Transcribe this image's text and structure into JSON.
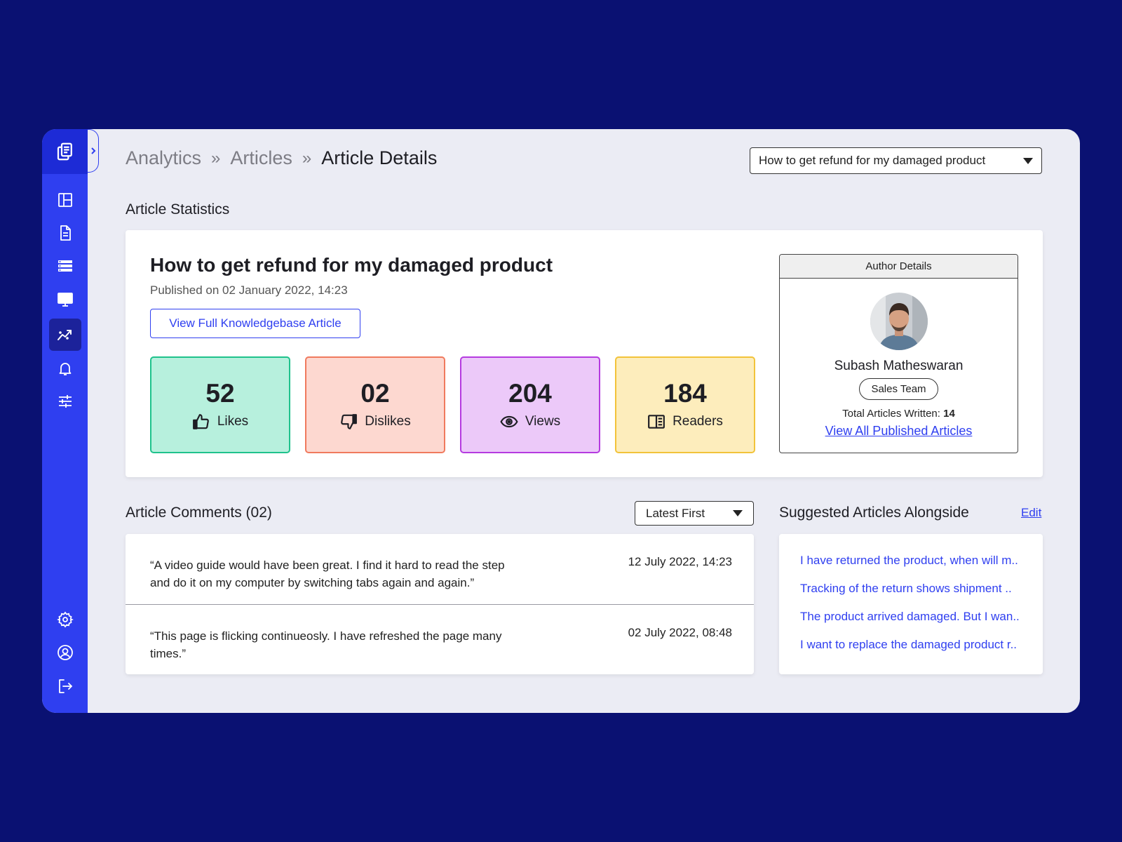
{
  "breadcrumb": {
    "items": [
      "Analytics",
      "Articles"
    ],
    "current": "Article Details"
  },
  "article_select": {
    "value": "How to get refund for my damaged product"
  },
  "statistics": {
    "section_title": "Article Statistics",
    "title": "How to get refund for my damaged product",
    "published": "Published on 02 January 2022, 14:23",
    "view_button": "View Full Knowledgebase Article",
    "stats": [
      {
        "value": "52",
        "label": "Likes",
        "icon": "thumbs-up-icon",
        "bg": "#b7f0dd",
        "border": "#1fc28c"
      },
      {
        "value": "02",
        "label": "Dislikes",
        "icon": "thumbs-down-icon",
        "bg": "#fdd8d0",
        "border": "#f07a5e"
      },
      {
        "value": "204",
        "label": "Views",
        "icon": "eye-icon",
        "bg": "#ecc9f9",
        "border": "#b53be0"
      },
      {
        "value": "184",
        "label": "Readers",
        "icon": "book-icon",
        "bg": "#fdedbc",
        "border": "#f2c33a"
      }
    ]
  },
  "author": {
    "heading": "Author Details",
    "name": "Subash Matheswaran",
    "team": "Sales Team",
    "total_label": "Total Articles Written:",
    "total_value": "14",
    "link": "View All Published Articles"
  },
  "comments": {
    "section_title": "Article Comments (02)",
    "sort": "Latest First",
    "items": [
      {
        "text": "“A video guide would have been great. I find it hard to read the step and do it on my computer by switching tabs again and again.”",
        "time": "12 July 2022, 14:23"
      },
      {
        "text": "“This page is flicking continueosly. I have refreshed the page many times.”",
        "time": "02 July 2022, 08:48"
      }
    ]
  },
  "suggested": {
    "section_title": "Suggested Articles Alongside",
    "edit": "Edit",
    "items": [
      "I have returned the product, when will m..",
      "Tracking of the return shows shipment ..",
      "The product arrived damaged. But I wan..",
      "I want to replace the damaged product r.."
    ]
  },
  "sidebar": {
    "items": [
      "dashboard-icon",
      "document-icon",
      "list-icon",
      "monitor-icon",
      "analytics-icon",
      "bell-icon",
      "sliders-icon"
    ],
    "bottom": [
      "gear-icon",
      "user-icon",
      "logout-icon"
    ],
    "active": "analytics-icon"
  },
  "colors": {
    "accent": "#2f3ff0",
    "background": "#0a1172",
    "panel": "#ebecf4"
  }
}
